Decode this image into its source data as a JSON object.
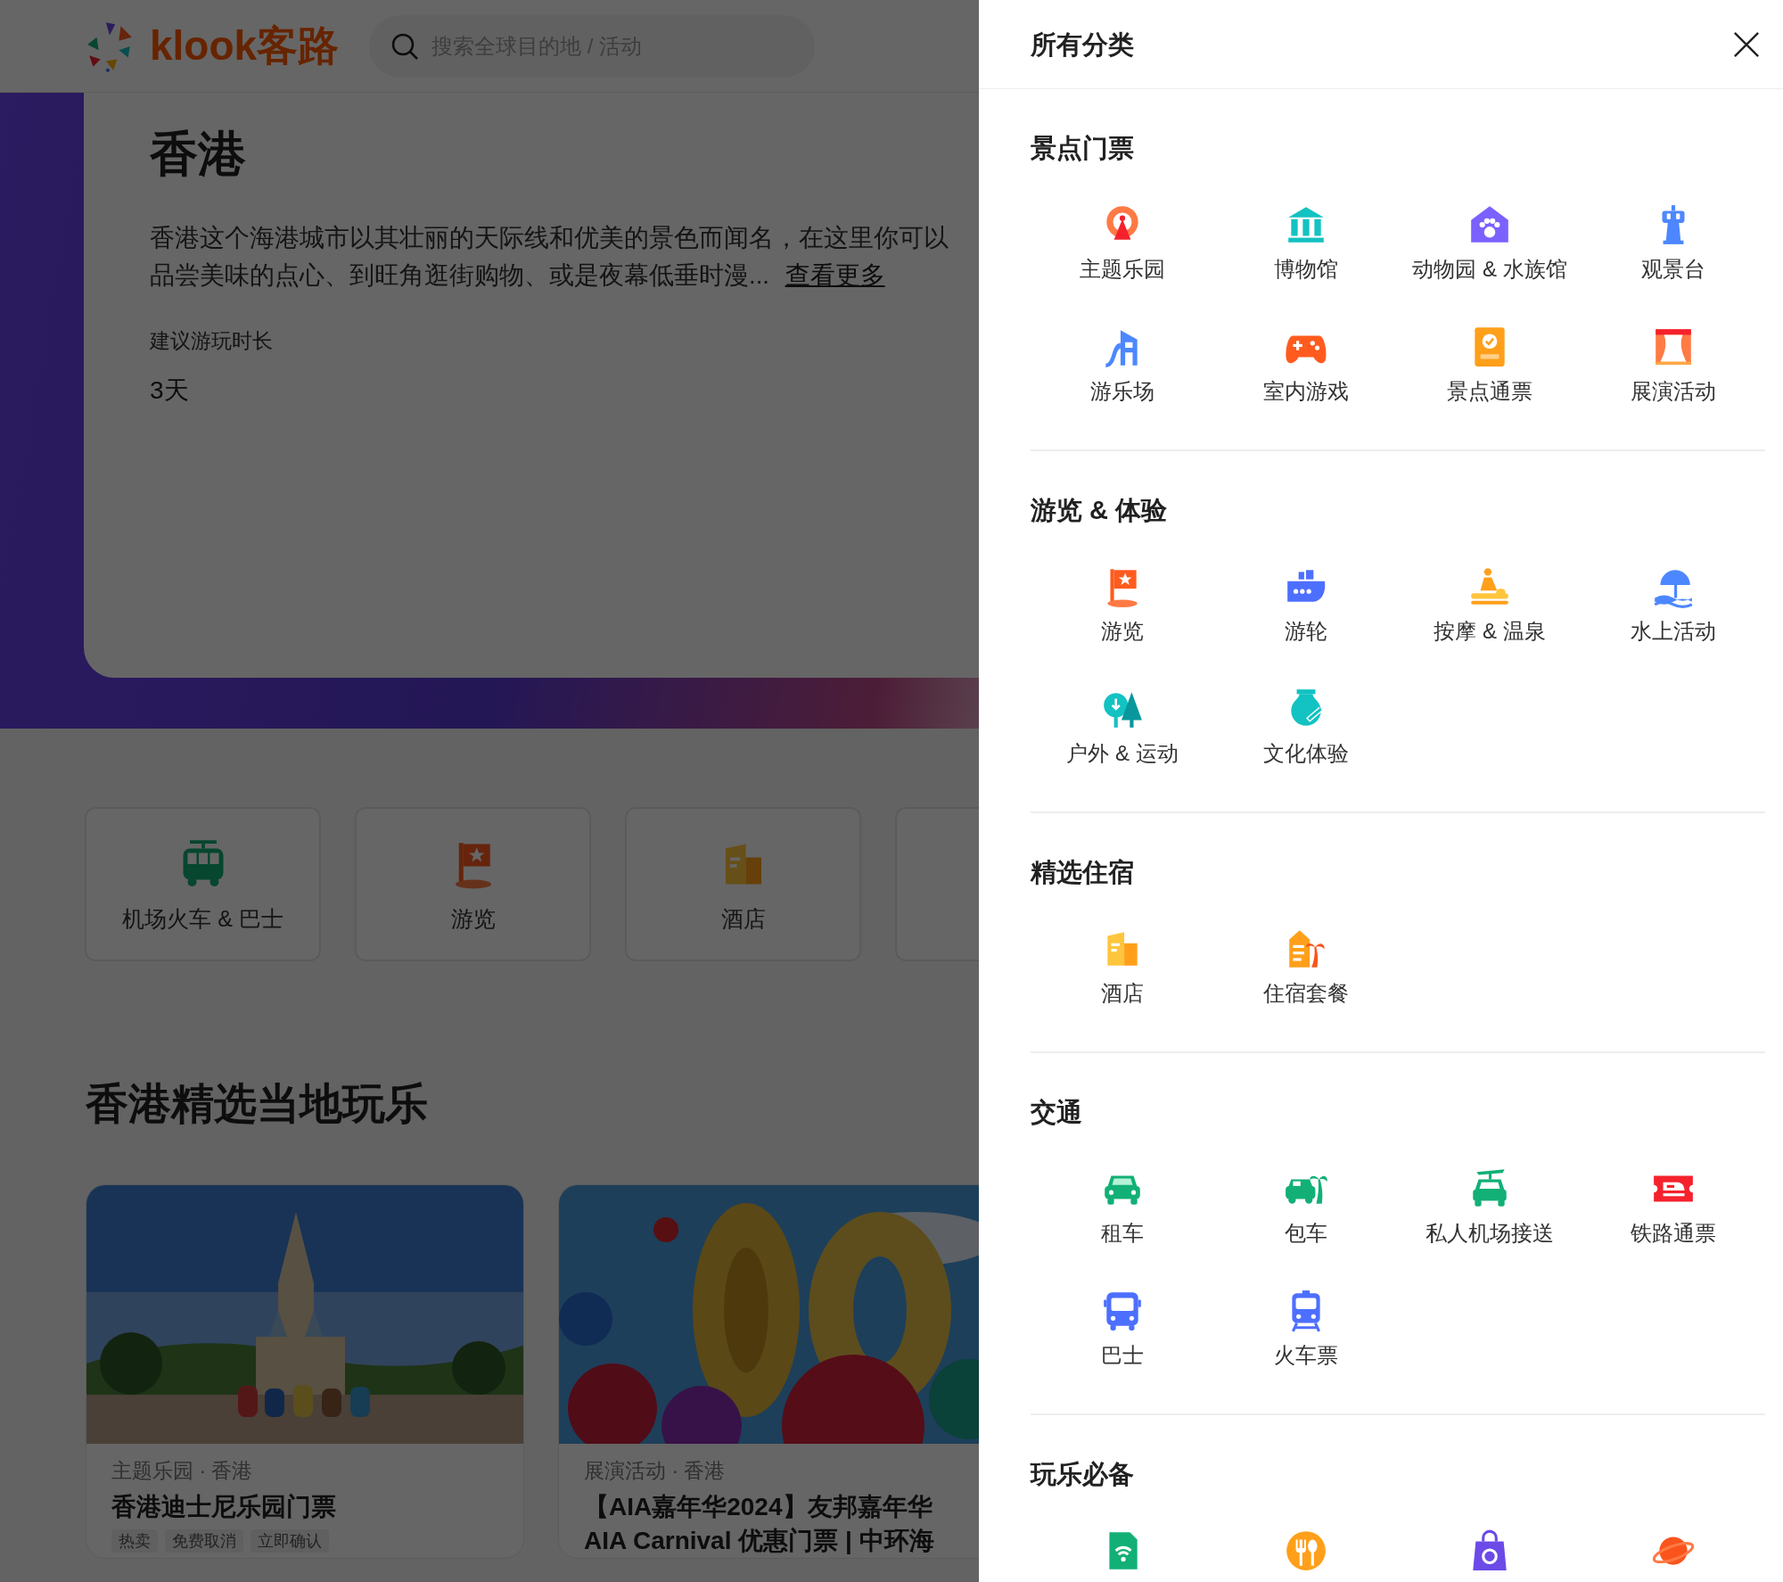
{
  "header": {
    "logo_text": "klook客路",
    "search": {
      "placeholder": "搜索全球目的地 / 活动"
    }
  },
  "destination": {
    "title": "香港",
    "description": "香港这个海港城市以其壮丽的天际线和优美的景色而闻名，在这里你可以品尝美味的点心、到旺角逛街购物、或是夜幕低垂时漫...",
    "more_link": "查看更多",
    "duration_label": "建议游玩时长",
    "duration_value": "3天"
  },
  "quick_categories": [
    {
      "kind": "card",
      "label": "机场火车 & 巴士"
    },
    {
      "kind": "card",
      "label": "游览"
    },
    {
      "kind": "card",
      "label": "酒店"
    },
    {
      "kind": "edge"
    }
  ],
  "featured": {
    "title": "香港精选当地玩乐",
    "cards": [
      {
        "kind": "picture",
        "category": "主题乐园 · 香港",
        "title": "香港迪士尼乐园门票",
        "tags": [
          "热卖",
          "免费取消",
          "立即确认"
        ]
      },
      {
        "kind": "picture",
        "category": "展演活动 · 香港",
        "title": "【AIA嘉年华2024】友邦嘉年华AIA Carnival 优惠门票 | 中环海"
      }
    ]
  },
  "panel": {
    "title": "所有分类",
    "sections": [
      {
        "title": "景点门票",
        "items": [
          {
            "label": "主题乐园"
          },
          {
            "label": "博物馆"
          },
          {
            "label": "动物园 & 水族馆"
          },
          {
            "label": "观景台"
          },
          {
            "label": "游乐场"
          },
          {
            "label": "室内游戏"
          },
          {
            "label": "景点通票"
          },
          {
            "label": "展演活动"
          }
        ]
      },
      {
        "title": "游览 & 体验",
        "items": [
          {
            "label": "游览"
          },
          {
            "label": "游轮"
          },
          {
            "label": "按摩 & 温泉"
          },
          {
            "label": "水上活动"
          },
          {
            "label": "户外 & 运动"
          },
          {
            "label": "文化体验"
          }
        ]
      },
      {
        "title": "精选住宿",
        "items": [
          {
            "label": "酒店"
          },
          {
            "label": "住宿套餐"
          }
        ]
      },
      {
        "title": "交通",
        "items": [
          {
            "label": "租车"
          },
          {
            "label": "包车"
          },
          {
            "label": "私人机场接送"
          },
          {
            "label": "铁路通票"
          },
          {
            "label": "巴士"
          },
          {
            "label": "火车票"
          }
        ]
      },
      {
        "title": "玩乐必备",
        "items": [
          {
            "kind": "icon_only"
          },
          {
            "kind": "icon_only"
          },
          {
            "kind": "icon_only"
          },
          {
            "kind": "icon_only"
          }
        ]
      }
    ]
  }
}
